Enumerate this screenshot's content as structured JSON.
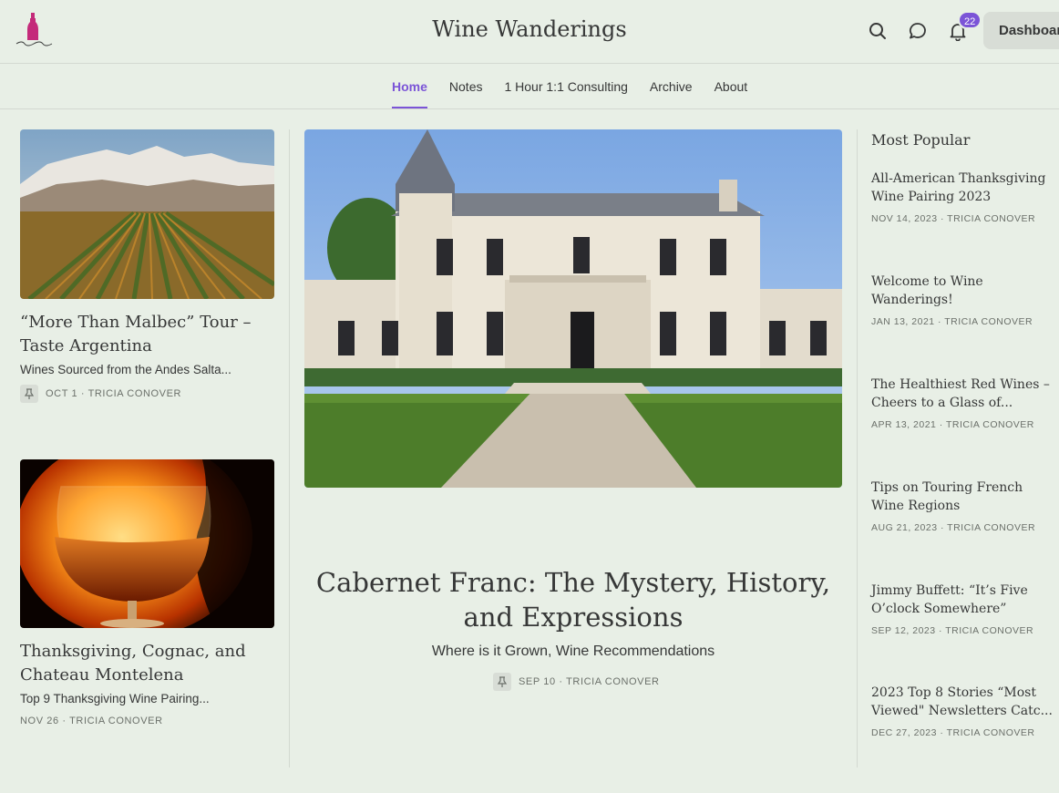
{
  "header": {
    "title": "Wine Wanderings",
    "notification_count": "22",
    "dashboard_label": "Dashboard"
  },
  "nav": {
    "items": [
      "Home",
      "Notes",
      "1 Hour 1:1 Consulting",
      "Archive",
      "About"
    ],
    "active": "Home"
  },
  "colors": {
    "accent": "#7b54d7",
    "background": "#e8efe6"
  },
  "left_posts": [
    {
      "title": "“More Than Malbec” Tour – Taste Argentina",
      "subtitle": "Wines Sourced from the Andes Salta...",
      "meta": "OCT 1 · TRICIA CONOVER",
      "pinned": true
    },
    {
      "title": "Thanksgiving, Cognac, and Chateau Montelena",
      "subtitle": "Top 9 Thanksgiving Wine Pairing...",
      "meta": "NOV 26 · TRICIA CONOVER",
      "pinned": false
    }
  ],
  "hero": {
    "title": "Cabernet Franc: The Mystery, History, and Expressions",
    "subtitle": "Where is it Grown, Wine Recommendations",
    "meta": "SEP 10 · TRICIA CONOVER",
    "pinned": true
  },
  "popular": {
    "heading": "Most Popular",
    "items": [
      {
        "title": "All-American Thanksgiving Wine Pairing 2023",
        "meta": "NOV 14, 2023 · TRICIA CONOVER"
      },
      {
        "title": "Welcome to Wine Wanderings!",
        "meta": "JAN 13, 2021 · TRICIA CONOVER"
      },
      {
        "title": "The Healthiest Red Wines – Cheers to a Glass of...",
        "meta": "APR 13, 2021 · TRICIA CONOVER"
      },
      {
        "title": "Tips on Touring French Wine Regions",
        "meta": "AUG 21, 2023 · TRICIA CONOVER"
      },
      {
        "title": "Jimmy Buffett: “It’s Five O’clock Somewhere”",
        "meta": "SEP 12, 2023 · TRICIA CONOVER"
      },
      {
        "title": "2023 Top 8 Stories “Most Viewed\" Newsletters Catc...",
        "meta": "DEC 27, 2023 · TRICIA CONOVER"
      }
    ]
  }
}
